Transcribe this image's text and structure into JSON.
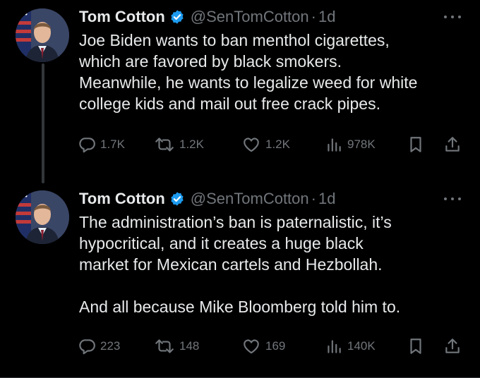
{
  "colors": {
    "background": "#000000",
    "text_primary": "#e7e9ea",
    "text_secondary": "#71767b",
    "verified_badge": "#1d9bf0",
    "thread_line": "#333639"
  },
  "tweets": [
    {
      "author": {
        "name": "Tom Cotton",
        "handle": "@SenTomCotton",
        "separator": "·",
        "time": "1d",
        "avatar_icon": "profile-photo",
        "verified_icon": "verified-badge-icon"
      },
      "text": "Joe Biden wants to ban menthol cigarettes,\nwhich are favored by black smokers.\nMeanwhile, he wants to legalize weed for white\ncollege kids and mail out free crack pipes.",
      "actions": {
        "replies": "1.7K",
        "reposts": "1.2K",
        "likes": "1.2K",
        "views": "978K"
      }
    },
    {
      "author": {
        "name": "Tom Cotton",
        "handle": "@SenTomCotton",
        "separator": "·",
        "time": "1d",
        "avatar_icon": "profile-photo",
        "verified_icon": "verified-badge-icon"
      },
      "text": "The administration’s ban is paternalistic, it’s\nhypocritical, and it creates a huge black\nmarket for Mexican cartels and Hezbollah.\n\nAnd all because Mike Bloomberg told him to.",
      "actions": {
        "replies": "223",
        "reposts": "148",
        "likes": "169",
        "views": "140K"
      }
    }
  ]
}
